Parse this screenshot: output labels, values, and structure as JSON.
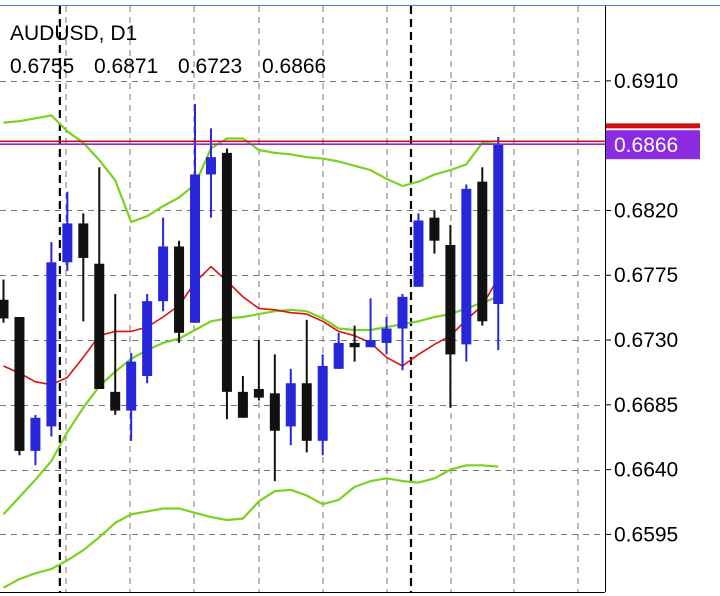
{
  "header": {
    "symbol": "AUDUSD, D1",
    "ohlc": [
      "0.6755",
      "0.6871",
      "0.6723",
      "0.6866"
    ]
  },
  "colors": {
    "bull": "#2727d9",
    "bear": "#111111",
    "ma": "#dd1111",
    "bands": "#7bd11f",
    "bid_line": "#d01010",
    "ask_line": "#8a2be2",
    "price_tag": "#8a2be2",
    "grid": "#777777",
    "axis": "#000000"
  },
  "chart_data": {
    "type": "candlestick",
    "ylim": [
      0.6555,
      0.6962
    ],
    "yticks": [
      "0.6910",
      "0.6820",
      "0.6775",
      "0.6730",
      "0.6685",
      "0.6640",
      "0.6595"
    ],
    "current_price": "0.6866",
    "bid": 0.6868,
    "ask": 0.6866,
    "period_separators": [
      4,
      26
    ],
    "candles": [
      {
        "o": 0.6758,
        "h": 0.6772,
        "l": 0.6742,
        "c": 0.6745
      },
      {
        "o": 0.6746,
        "h": 0.6746,
        "l": 0.665,
        "c": 0.6653
      },
      {
        "o": 0.6653,
        "h": 0.6678,
        "l": 0.6643,
        "c": 0.6676
      },
      {
        "o": 0.667,
        "h": 0.6798,
        "l": 0.6663,
        "c": 0.6784
      },
      {
        "o": 0.6784,
        "h": 0.6833,
        "l": 0.6778,
        "c": 0.6811
      },
      {
        "o": 0.6811,
        "h": 0.6818,
        "l": 0.6743,
        "c": 0.6787
      },
      {
        "o": 0.6783,
        "h": 0.685,
        "l": 0.6708,
        "c": 0.6696
      },
      {
        "o": 0.6694,
        "h": 0.6762,
        "l": 0.6678,
        "c": 0.6681
      },
      {
        "o": 0.6681,
        "h": 0.6721,
        "l": 0.666,
        "c": 0.6715
      },
      {
        "o": 0.6705,
        "h": 0.6762,
        "l": 0.67,
        "c": 0.6757
      },
      {
        "o": 0.6757,
        "h": 0.6815,
        "l": 0.675,
        "c": 0.6795
      },
      {
        "o": 0.6795,
        "h": 0.6799,
        "l": 0.6728,
        "c": 0.6735
      },
      {
        "o": 0.6742,
        "h": 0.6894,
        "l": 0.6742,
        "c": 0.6845
      },
      {
        "o": 0.6845,
        "h": 0.6877,
        "l": 0.6815,
        "c": 0.6857
      },
      {
        "o": 0.686,
        "h": 0.6863,
        "l": 0.6675,
        "c": 0.6694
      },
      {
        "o": 0.6694,
        "h": 0.6705,
        "l": 0.6678,
        "c": 0.6676
      },
      {
        "o": 0.6696,
        "h": 0.673,
        "l": 0.6688,
        "c": 0.669
      },
      {
        "o": 0.6693,
        "h": 0.672,
        "l": 0.6632,
        "c": 0.6667
      },
      {
        "o": 0.667,
        "h": 0.671,
        "l": 0.6657,
        "c": 0.67
      },
      {
        "o": 0.67,
        "h": 0.6744,
        "l": 0.6652,
        "c": 0.666
      },
      {
        "o": 0.666,
        "h": 0.672,
        "l": 0.665,
        "c": 0.6712
      },
      {
        "o": 0.671,
        "h": 0.6735,
        "l": 0.671,
        "c": 0.6728
      },
      {
        "o": 0.6728,
        "h": 0.674,
        "l": 0.6715,
        "c": 0.6725
      },
      {
        "o": 0.6725,
        "h": 0.6759,
        "l": 0.6725,
        "c": 0.673
      },
      {
        "o": 0.6728,
        "h": 0.6746,
        "l": 0.672,
        "c": 0.6738
      },
      {
        "o": 0.6738,
        "h": 0.6762,
        "l": 0.6709,
        "c": 0.676
      },
      {
        "o": 0.6767,
        "h": 0.6818,
        "l": 0.6767,
        "c": 0.6813
      },
      {
        "o": 0.6815,
        "h": 0.682,
        "l": 0.679,
        "c": 0.6799
      },
      {
        "o": 0.6796,
        "h": 0.681,
        "l": 0.6683,
        "c": 0.672
      },
      {
        "o": 0.6727,
        "h": 0.6838,
        "l": 0.6715,
        "c": 0.6835
      },
      {
        "o": 0.684,
        "h": 0.685,
        "l": 0.674,
        "c": 0.6743
      },
      {
        "o": 0.6755,
        "h": 0.6871,
        "l": 0.6723,
        "c": 0.6866
      }
    ],
    "ma": [
      0.6712,
      0.6707,
      0.6701,
      0.6699,
      0.6704,
      0.6718,
      0.6733,
      0.6736,
      0.6736,
      0.6739,
      0.6746,
      0.6754,
      0.677,
      0.6781,
      0.6771,
      0.676,
      0.6752,
      0.6751,
      0.6749,
      0.6748,
      0.6743,
      0.6736,
      0.6733,
      0.6728,
      0.6718,
      0.6712,
      0.672,
      0.6727,
      0.6733,
      0.6744,
      0.6754,
      0.6773
    ],
    "upper_band": [
      0.6881,
      0.6882,
      0.6884,
      0.6886,
      0.6875,
      0.6867,
      0.6855,
      0.6841,
      0.6812,
      0.6816,
      0.6823,
      0.6829,
      0.6838,
      0.6863,
      0.687,
      0.687,
      0.6862,
      0.686,
      0.6859,
      0.6857,
      0.6856,
      0.6854,
      0.6851,
      0.6848,
      0.6842,
      0.6837,
      0.684,
      0.6845,
      0.6848,
      0.6852,
      0.6867,
      0.6866
    ],
    "mid_band": [
      0.6609,
      0.6621,
      0.6633,
      0.6646,
      0.6666,
      0.6683,
      0.6698,
      0.6708,
      0.6717,
      0.6723,
      0.6728,
      0.6731,
      0.6737,
      0.6743,
      0.6745,
      0.6746,
      0.6748,
      0.675,
      0.6751,
      0.675,
      0.6745,
      0.6738,
      0.6737,
      0.6737,
      0.6739,
      0.6741,
      0.6743,
      0.6746,
      0.6748,
      0.6752,
      0.6756,
      0.676
    ],
    "lower_band": [
      0.6558,
      0.6564,
      0.6568,
      0.6571,
      0.6577,
      0.6584,
      0.6593,
      0.6603,
      0.6609,
      0.6611,
      0.6613,
      0.6613,
      0.661,
      0.6607,
      0.6605,
      0.6606,
      0.6618,
      0.6625,
      0.6626,
      0.6622,
      0.6616,
      0.6619,
      0.6628,
      0.6632,
      0.6634,
      0.6632,
      0.6631,
      0.6634,
      0.664,
      0.6643,
      0.6643,
      0.6642
    ]
  }
}
